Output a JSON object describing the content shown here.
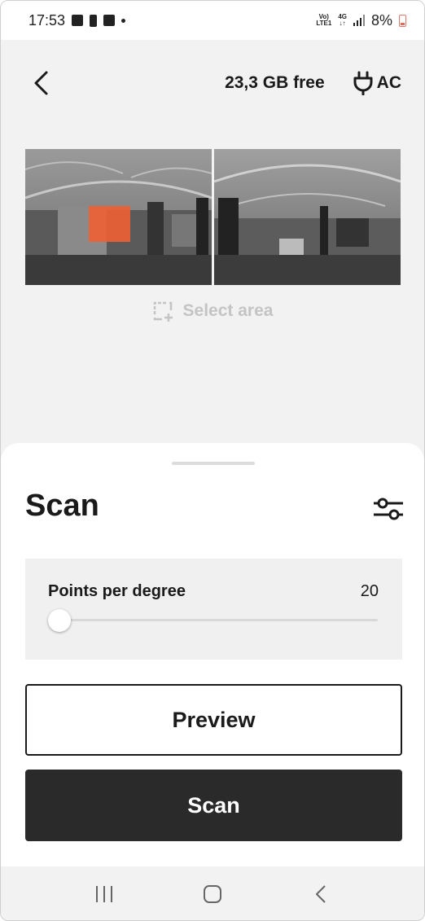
{
  "status_bar": {
    "time": "17:53",
    "network_top": "Vo)",
    "network_bottom": "LTE1",
    "data_type": "4G",
    "battery": "8%"
  },
  "top_bar": {
    "storage": "23,3 GB free",
    "power_source": "AC"
  },
  "preview": {
    "select_area_label": "Select area",
    "selection_color": "#f05f32"
  },
  "sheet": {
    "title": "Scan",
    "points_per_degree": {
      "label": "Points per degree",
      "value": "20"
    },
    "preview_button": "Preview",
    "scan_button": "Scan"
  },
  "colors": {
    "background": "#f2f2f2",
    "primary_button": "#2a2a2a",
    "text": "#1a1a1a",
    "muted": "#c4c4c4"
  }
}
